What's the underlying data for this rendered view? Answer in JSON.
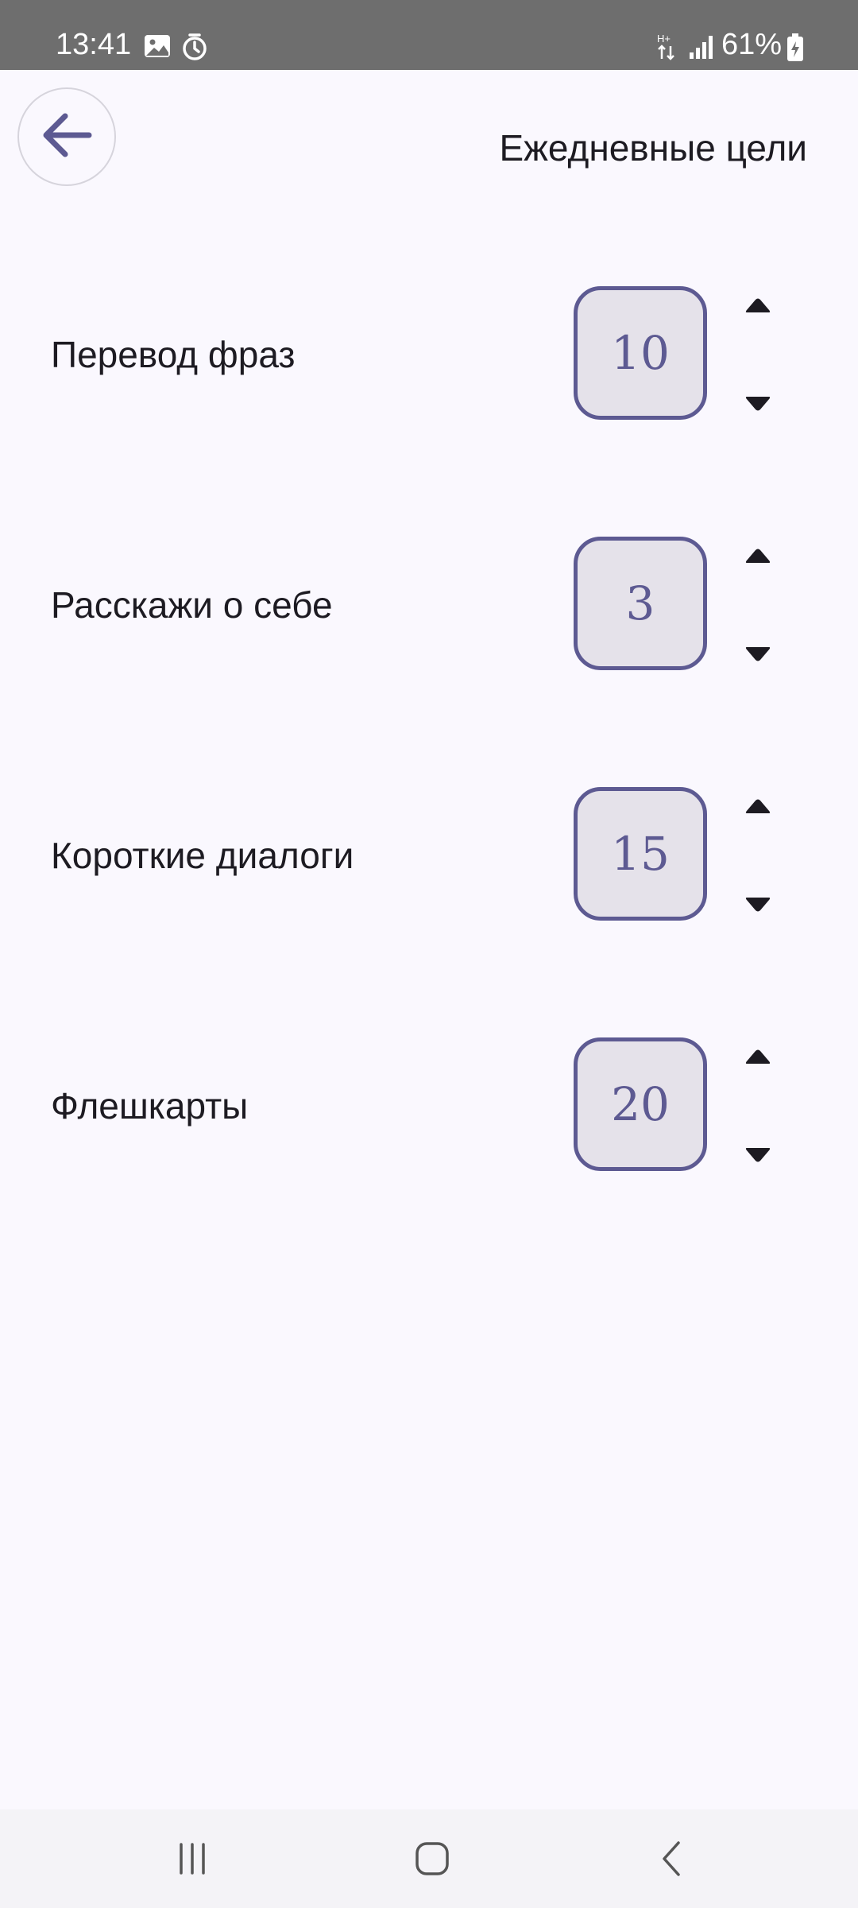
{
  "status_bar": {
    "time": "13:41",
    "battery_percent": "61%",
    "icons": [
      "image-icon",
      "alarm-icon",
      "data-arrows-icon",
      "signal-icon",
      "battery-charging-icon"
    ]
  },
  "header": {
    "title": "Ежедневные цели",
    "back_icon": "arrow-left-icon"
  },
  "goals": [
    {
      "label": "Перевод фраз",
      "value": "10"
    },
    {
      "label": "Расскажи о себе",
      "value": "3"
    },
    {
      "label": "Короткие диалоги",
      "value": "15"
    },
    {
      "label": "Флешкарты",
      "value": "20"
    }
  ],
  "nav_bar": {
    "icons": [
      "recent-apps-icon",
      "home-icon",
      "nav-back-icon"
    ]
  },
  "colors": {
    "accent": "#5d5a92",
    "field_background": "#e5e2ea",
    "page_background": "#faf8fe",
    "text": "#1d1b22"
  }
}
